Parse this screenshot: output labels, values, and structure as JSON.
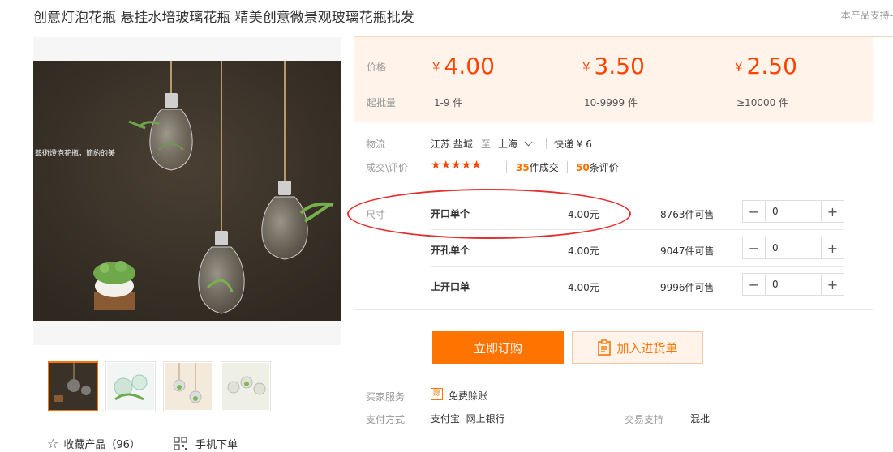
{
  "title": "创意灯泡花瓶 悬挂水培玻璃花瓶 精美创意微景观玻璃花瓶批发",
  "support_text": "本产品支持-",
  "gallery": {
    "thumbs": [
      "thumb-1",
      "thumb-2",
      "thumb-3",
      "thumb-4"
    ],
    "photo_caption": "藝術燈泡花瓶，簡約的美",
    "favorite_label": "收藏产品（96）",
    "mobile_label": "手机下单"
  },
  "price": {
    "price_label": "价格",
    "batch_label": "起批量",
    "currency": "¥",
    "tiers": [
      {
        "price": "4.00",
        "range": "1-9 件"
      },
      {
        "price": "3.50",
        "range": "10-9999 件"
      },
      {
        "price": "2.50",
        "range": "≥10000 件"
      }
    ]
  },
  "logistics": {
    "label": "物流",
    "from": "江苏 盐城",
    "to_word": "至",
    "to": "上海",
    "express": "快递 ¥ 6"
  },
  "reviews": {
    "label": "成交\\评价",
    "stars": "★★★★★",
    "deals_count": "35",
    "deals_text": "件成交",
    "review_count": "50",
    "review_text": "条评价"
  },
  "sku": {
    "label": "尺寸",
    "rows": [
      {
        "name": "开口单个",
        "price": "4.00元",
        "stock": "8763件可售",
        "qty": "0"
      },
      {
        "name": "开孔单个",
        "price": "4.00元",
        "stock": "9047件可售",
        "qty": "0"
      },
      {
        "name": "上开口单",
        "price": "4.00元",
        "stock": "9996件可售",
        "qty": "0"
      }
    ],
    "minus": "−",
    "plus": "+"
  },
  "actions": {
    "buy_label": "立即订购",
    "cart_label": "加入进货单"
  },
  "services": {
    "buyer_label": "买家服务",
    "buyer_icon_text": "赊",
    "buyer_value": "免费赊账",
    "pay_label": "支付方式",
    "pay_values": "支付宝  网上银行",
    "trade_label": "交易支持",
    "trade_value": "混批"
  },
  "colors": {
    "accent": "#ff7300",
    "price": "#ff4400",
    "annotation": "#e3312f",
    "price_band_bg": "#fff3ea"
  }
}
